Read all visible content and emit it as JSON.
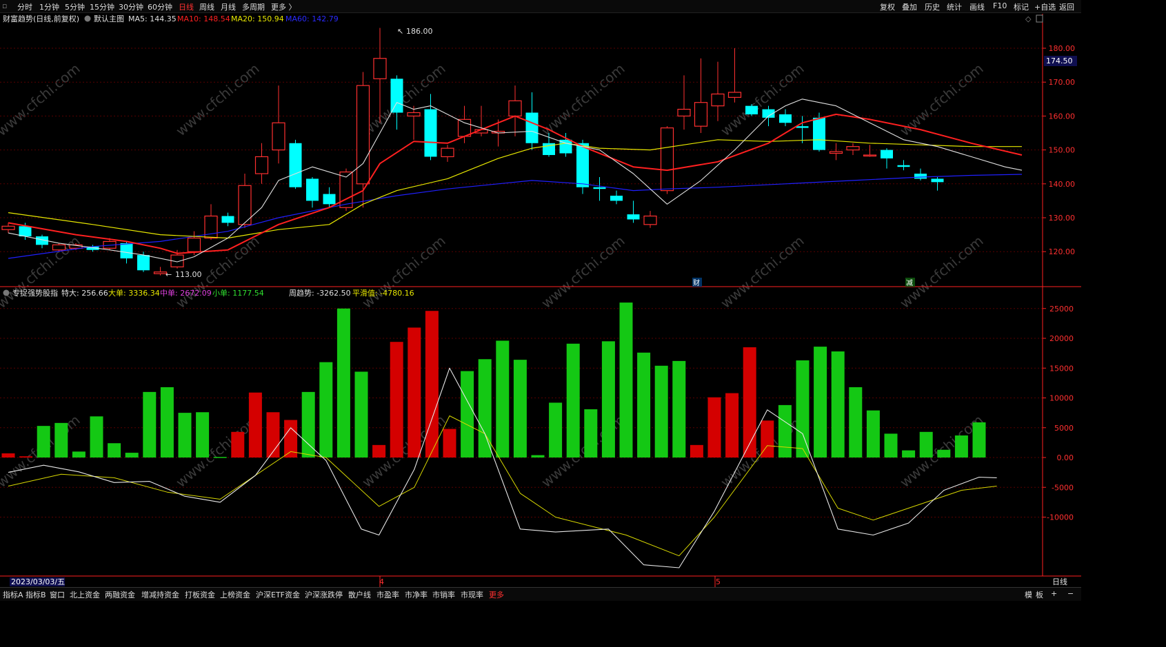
{
  "toolbar": {
    "left": [
      "分时",
      "1分钟",
      "5分钟",
      "15分钟",
      "30分钟",
      "60分钟",
      "日线",
      "周线",
      "月线",
      "多周期",
      "更多 〉"
    ],
    "active": "日线",
    "right": [
      "复权",
      "叠加",
      "历史",
      "统计",
      "画线",
      "F10",
      "标记",
      "+自选",
      "返回"
    ]
  },
  "main_legend": {
    "title": "财富趋势(日线,前复权)",
    "mode": "默认主图",
    "ma5": "MA5: 144.35",
    "ma10": "MA10: 148.54",
    "ma20": "MA20: 150.94",
    "ma60": "MA60: 142.79"
  },
  "sub_legend": {
    "title": "专捉强势股指",
    "te": "特大: 256.66",
    "da": "大单: 3336.34",
    "zhong": "中单: 2672.09",
    "xiao": "小单: 1177.54",
    "zhou": "周趋势: -3262.50",
    "ph": "平滑值: -4780.16"
  },
  "price_marker": "174.50",
  "high_label": "186.00",
  "low_label": "113.00",
  "event_badges": [
    "财",
    "减"
  ],
  "watermark": "www.cfchi.com",
  "bottom_right": "日线",
  "date_label": "2023/03/03/五",
  "month_labels": [
    "4",
    "5"
  ],
  "bottombar": {
    "items": [
      "指标A",
      "指标B",
      "窗口",
      "北上资金",
      "两融资金",
      "增减持资金",
      "打板资金",
      "上榜资金",
      "沪深ETF资金",
      "沪深涨跌停",
      "散户线",
      "市盈率",
      "市净率",
      "市销率",
      "市现率",
      "更多"
    ],
    "right": [
      "模",
      "板",
      "+",
      "−"
    ]
  },
  "colors": {
    "up": "#ff3030",
    "down": "#00ffff",
    "ma5": "#e0e0e0",
    "ma10": "#ff2020",
    "ma20": "#e8e800",
    "ma60": "#2020ff",
    "bar_pos": "#14c814",
    "bar_neg": "#d40000",
    "grid": "#5a0000",
    "axis": "#ff2020"
  },
  "chart_data": [
    {
      "type": "candlestick",
      "title": "财富趋势(日线,前复权)",
      "yticks": [
        120,
        130,
        140,
        150,
        160,
        170,
        180
      ],
      "ylim": [
        111,
        187
      ],
      "candles": [
        [
          126.5,
          127.5,
          125.5,
          128.5
        ],
        [
          127.5,
          124.5,
          123.5,
          128.5
        ],
        [
          124.5,
          122.0,
          121.0,
          125.0
        ],
        [
          120.5,
          122.0,
          120.0,
          122.5
        ],
        [
          121.0,
          122.0,
          120.5,
          122.5
        ],
        [
          121.5,
          120.5,
          120.0,
          122.0
        ],
        [
          121.0,
          123.0,
          120.5,
          124.0
        ],
        [
          122.5,
          118.0,
          116.5,
          123.0
        ],
        [
          119.0,
          114.5,
          114.0,
          120.0
        ],
        [
          113.5,
          114.0,
          113.0,
          115.5
        ],
        [
          115.5,
          119.0,
          115.0,
          120.5
        ],
        [
          120.0,
          124.0,
          119.0,
          126.0
        ],
        [
          124.0,
          130.5,
          123.5,
          134.0
        ],
        [
          130.5,
          128.5,
          127.5,
          131.5
        ],
        [
          128.0,
          139.5,
          127.0,
          143.0
        ],
        [
          143.0,
          148.0,
          140.0,
          152.0
        ],
        [
          150.0,
          158.0,
          146.0,
          169.0
        ],
        [
          152.0,
          139.0,
          138.5,
          153.0
        ],
        [
          141.5,
          135.0,
          133.0,
          142.0
        ],
        [
          137.0,
          134.0,
          133.0,
          139.0
        ],
        [
          133.0,
          143.5,
          132.0,
          144.5
        ],
        [
          140.0,
          169.0,
          133.0,
          173.0
        ],
        [
          171.0,
          177.0,
          158.0,
          186.0
        ],
        [
          171.0,
          161.0,
          156.0,
          172.0
        ],
        [
          160.0,
          161.0,
          153.0,
          163.0
        ],
        [
          162.0,
          148.0,
          147.0,
          166.5
        ],
        [
          148.0,
          150.5,
          146.5,
          151.5
        ],
        [
          154.0,
          159.0,
          152.0,
          163.0
        ],
        [
          155.0,
          156.0,
          154.0,
          163.0
        ],
        [
          155.0,
          155.5,
          151.0,
          159.0
        ],
        [
          160.0,
          164.5,
          154.0,
          169.0
        ],
        [
          161.0,
          152.0,
          150.0,
          167.0
        ],
        [
          152.0,
          148.5,
          148.0,
          155.0
        ],
        [
          153.0,
          149.0,
          148.0,
          155.0
        ],
        [
          152.0,
          139.0,
          137.0,
          153.0
        ],
        [
          139.0,
          138.5,
          135.0,
          142.0
        ],
        [
          136.5,
          135.0,
          134.0,
          138.0
        ],
        [
          131.0,
          129.5,
          128.5,
          135.0
        ],
        [
          128.0,
          130.5,
          127.0,
          132.0
        ],
        [
          138.0,
          156.5,
          137.0,
          157.0
        ],
        [
          160.0,
          162.0,
          156.0,
          172.0
        ],
        [
          157.0,
          164.0,
          155.0,
          177.0
        ],
        [
          163.0,
          166.5,
          158.5,
          176.0
        ],
        [
          165.5,
          167.0,
          164.0,
          180.0
        ],
        [
          163.0,
          160.5,
          160.0,
          163.5
        ],
        [
          162.0,
          159.5,
          157.0,
          163.0
        ],
        [
          160.5,
          158.0,
          157.0,
          162.0
        ],
        [
          157.0,
          156.5,
          152.0,
          160.0
        ],
        [
          159.5,
          150.0,
          149.5,
          161.0
        ],
        [
          149.0,
          149.5,
          147.0,
          152.0
        ],
        [
          150.0,
          151.0,
          148.5,
          152.0
        ],
        [
          148.5,
          148.5,
          148.0,
          151.5
        ],
        [
          150.0,
          147.5,
          144.5,
          150.5
        ],
        [
          145.5,
          145.0,
          144.0,
          147.0
        ],
        [
          143.0,
          141.5,
          141.0,
          144.5
        ],
        [
          141.5,
          140.5,
          138.0,
          142.0
        ]
      ],
      "ma5": [
        [
          0,
          125.5
        ],
        [
          3,
          122.5
        ],
        [
          6,
          120.5
        ],
        [
          8,
          119.0
        ],
        [
          10,
          117.0
        ],
        [
          11,
          118.5
        ],
        [
          13,
          124.0
        ],
        [
          15,
          133.0
        ],
        [
          16,
          141.0
        ],
        [
          18,
          145.0
        ],
        [
          20,
          142.0
        ],
        [
          21,
          146.0
        ],
        [
          22,
          155.0
        ],
        [
          23,
          164.0
        ],
        [
          24,
          162.0
        ],
        [
          25,
          163.0
        ],
        [
          27,
          158.0
        ],
        [
          29,
          155.0
        ],
        [
          31,
          155.5
        ],
        [
          33,
          152.0
        ],
        [
          35,
          150.0
        ],
        [
          37,
          143.0
        ],
        [
          39,
          134.0
        ],
        [
          41,
          141.0
        ],
        [
          43,
          150.0
        ],
        [
          45,
          160.0
        ],
        [
          46,
          163.0
        ],
        [
          47,
          165.0
        ],
        [
          49,
          163.0
        ],
        [
          51,
          158.0
        ],
        [
          53,
          153.0
        ],
        [
          55,
          151.0
        ],
        [
          57,
          148.0
        ],
        [
          59,
          145.0
        ],
        [
          60,
          144.0
        ]
      ],
      "ma10": [
        [
          0,
          128.5
        ],
        [
          4,
          125.0
        ],
        [
          7,
          123.0
        ],
        [
          9,
          121.0
        ],
        [
          10,
          119.5
        ],
        [
          13,
          120.5
        ],
        [
          16,
          128.0
        ],
        [
          19,
          133.0
        ],
        [
          21,
          138.0
        ],
        [
          22,
          146.0
        ],
        [
          24,
          152.5
        ],
        [
          26,
          152.0
        ],
        [
          28,
          156.0
        ],
        [
          30,
          160.0
        ],
        [
          32,
          156.0
        ],
        [
          34,
          151.0
        ],
        [
          37,
          145.0
        ],
        [
          39,
          144.0
        ],
        [
          42,
          146.5
        ],
        [
          45,
          152.0
        ],
        [
          47,
          158.0
        ],
        [
          49,
          160.5
        ],
        [
          51,
          159.0
        ],
        [
          54,
          156.0
        ],
        [
          57,
          152.0
        ],
        [
          60,
          148.5
        ]
      ],
      "ma20": [
        [
          0,
          131.5
        ],
        [
          5,
          128.0
        ],
        [
          9,
          125.0
        ],
        [
          13,
          124.0
        ],
        [
          16,
          126.5
        ],
        [
          19,
          128.0
        ],
        [
          21,
          134.0
        ],
        [
          23,
          138.0
        ],
        [
          26,
          141.5
        ],
        [
          29,
          147.5
        ],
        [
          31,
          150.5
        ],
        [
          33,
          152.0
        ],
        [
          35,
          150.5
        ],
        [
          38,
          150.0
        ],
        [
          40,
          151.5
        ],
        [
          42,
          153.0
        ],
        [
          45,
          152.5
        ],
        [
          48,
          153.0
        ],
        [
          51,
          152.0
        ],
        [
          54,
          151.5
        ],
        [
          57,
          151.0
        ],
        [
          60,
          151.0
        ]
      ],
      "ma60": [
        [
          0,
          118.0
        ],
        [
          5,
          121.5
        ],
        [
          9,
          123.0
        ],
        [
          13,
          126.0
        ],
        [
          16,
          130.0
        ],
        [
          20,
          134.0
        ],
        [
          23,
          136.5
        ],
        [
          26,
          138.5
        ],
        [
          29,
          140.0
        ],
        [
          31,
          141.0
        ],
        [
          34,
          140.0
        ],
        [
          37,
          138.0
        ],
        [
          39,
          138.5
        ],
        [
          42,
          139.0
        ],
        [
          46,
          140.0
        ],
        [
          50,
          141.0
        ],
        [
          54,
          142.0
        ],
        [
          57,
          142.5
        ],
        [
          60,
          142.8
        ]
      ],
      "high": 186.0,
      "low": 113.0
    },
    {
      "type": "bar+line",
      "title": "专捉强势股指",
      "yticks": [
        -10000,
        -5000,
        0,
        5000,
        10000,
        15000,
        20000,
        25000
      ],
      "ylim": [
        -19500,
        26500
      ],
      "bars": [
        [
          1,
          700
        ],
        [
          1,
          200
        ],
        [
          0,
          5300
        ],
        [
          0,
          5800
        ],
        [
          0,
          1000
        ],
        [
          0,
          6900
        ],
        [
          0,
          2400
        ],
        [
          0,
          800
        ],
        [
          0,
          11000
        ],
        [
          0,
          11800
        ],
        [
          0,
          7500
        ],
        [
          0,
          7600
        ],
        [
          0,
          100
        ],
        [
          1,
          4300
        ],
        [
          1,
          10900
        ],
        [
          1,
          7600
        ],
        [
          1,
          6300
        ],
        [
          0,
          11000
        ],
        [
          0,
          16000
        ],
        [
          0,
          25000
        ],
        [
          0,
          14400
        ],
        [
          1,
          2100
        ],
        [
          1,
          19400
        ],
        [
          1,
          21800
        ],
        [
          1,
          24600
        ],
        [
          1,
          4800
        ],
        [
          0,
          14500
        ],
        [
          0,
          16500
        ],
        [
          0,
          19600
        ],
        [
          0,
          16400
        ],
        [
          0,
          400
        ],
        [
          0,
          9200
        ],
        [
          0,
          19100
        ],
        [
          0,
          8100
        ],
        [
          0,
          19500
        ],
        [
          0,
          26000
        ],
        [
          0,
          17600
        ],
        [
          0,
          15400
        ],
        [
          0,
          16200
        ],
        [
          1,
          2100
        ],
        [
          1,
          10100
        ],
        [
          1,
          10800
        ],
        [
          1,
          18500
        ],
        [
          1,
          6200
        ],
        [
          0,
          8800
        ],
        [
          0,
          16300
        ],
        [
          0,
          18600
        ],
        [
          0,
          17800
        ],
        [
          0,
          11800
        ],
        [
          0,
          7900
        ],
        [
          0,
          4000
        ],
        [
          0,
          1200
        ],
        [
          0,
          4300
        ],
        [
          0,
          1300
        ],
        [
          0,
          3700
        ],
        [
          0,
          5900
        ]
      ],
      "white": [
        [
          0,
          -2500
        ],
        [
          2,
          -1300
        ],
        [
          4,
          -2400
        ],
        [
          6,
          -4200
        ],
        [
          8,
          -4000
        ],
        [
          10,
          -6500
        ],
        [
          12,
          -7500
        ],
        [
          14,
          -3000
        ],
        [
          16,
          5000
        ],
        [
          18,
          -500
        ],
        [
          20,
          -12000
        ],
        [
          21,
          -13000
        ],
        [
          23,
          -2000
        ],
        [
          25,
          15000
        ],
        [
          27,
          4000
        ],
        [
          29,
          -12000
        ],
        [
          31,
          -12500
        ],
        [
          34,
          -12000
        ],
        [
          36,
          -18000
        ],
        [
          38,
          -18500
        ],
        [
          40,
          -9000
        ],
        [
          43,
          8000
        ],
        [
          45,
          4000
        ],
        [
          47,
          -12000
        ],
        [
          49,
          -13000
        ],
        [
          51,
          -11000
        ],
        [
          53,
          -5500
        ],
        [
          55,
          -3300
        ],
        [
          56,
          -3400
        ]
      ],
      "yellow": [
        [
          0,
          -4800
        ],
        [
          3,
          -2800
        ],
        [
          6,
          -3400
        ],
        [
          9,
          -5800
        ],
        [
          12,
          -7000
        ],
        [
          16,
          1000
        ],
        [
          18,
          0
        ],
        [
          21,
          -8200
        ],
        [
          23,
          -5000
        ],
        [
          25,
          7000
        ],
        [
          27,
          4000
        ],
        [
          29,
          -6000
        ],
        [
          31,
          -10000
        ],
        [
          35,
          -13000
        ],
        [
          38,
          -16500
        ],
        [
          40,
          -10000
        ],
        [
          43,
          2000
        ],
        [
          45,
          1500
        ],
        [
          47,
          -8500
        ],
        [
          49,
          -10500
        ],
        [
          51,
          -8500
        ],
        [
          54,
          -5500
        ],
        [
          56,
          -4800
        ]
      ]
    }
  ]
}
